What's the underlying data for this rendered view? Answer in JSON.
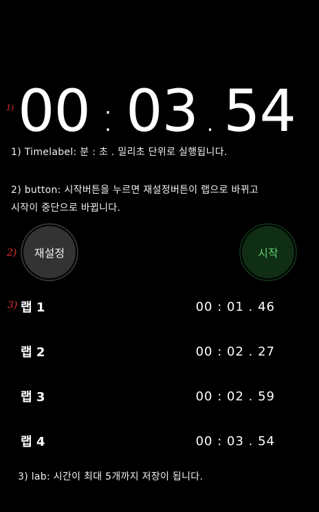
{
  "markers": {
    "m1": "1)",
    "m2": "2)",
    "m3": "3)"
  },
  "timer": {
    "minutes": "00",
    "separator": ":",
    "seconds": "03",
    "dot": ".",
    "centiseconds": "54"
  },
  "notes": {
    "timelabel": "1) Timelabel: 분 : 초 . 밀리초 단위로 실행됩니다.",
    "button_line1": "2) button: 시작버튼을 누르면 재설정버튼이 랩으로 바뀌고",
    "button_line2": "시작이 중단으로 바뀝니다.",
    "lab": "3) lab: 시간이 최대 5개까지 저장이 됩니다."
  },
  "buttons": {
    "reset_label": "재설정",
    "start_label": "시작"
  },
  "laps": [
    {
      "label": "랩 1",
      "time": "00 : 01 . 46"
    },
    {
      "label": "랩 2",
      "time": "00 : 02 . 27"
    },
    {
      "label": "랩 3",
      "time": "00 : 02 . 59"
    },
    {
      "label": "랩 4",
      "time": "00 : 03 . 54"
    }
  ],
  "colors": {
    "background": "#000000",
    "marker_red": "#e8332f",
    "start_green": "#5fd071",
    "start_bg": "#0f2e14",
    "reset_bg": "#333333"
  }
}
